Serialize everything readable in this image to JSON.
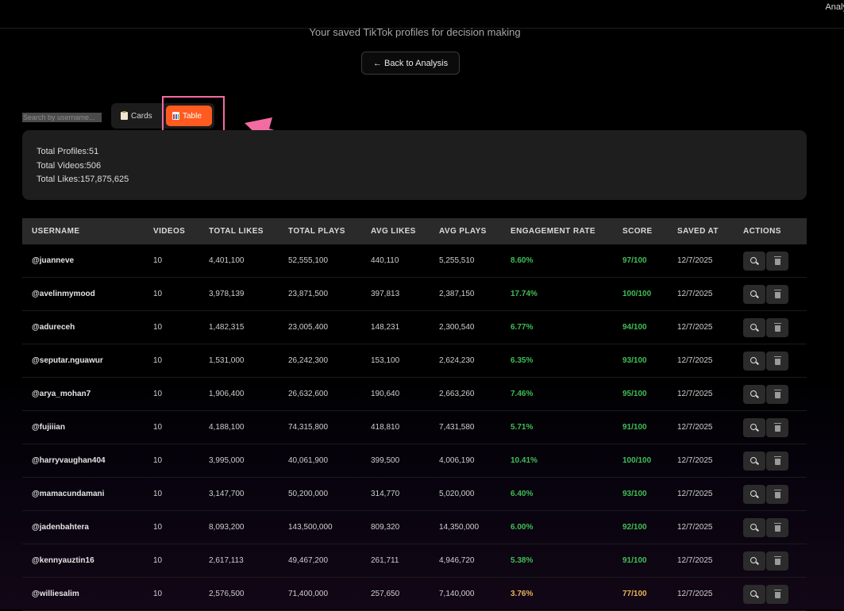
{
  "header": {
    "nav_cut_label": "Analy",
    "subtitle": "Your saved TikTok profiles for decision making"
  },
  "back_button": {
    "label": "← Back to Analysis"
  },
  "search": {
    "placeholder": "Search by username..."
  },
  "view_toggle": {
    "cards_label": "Cards",
    "cards_icon": "clipboard-icon",
    "table_label": "Table",
    "table_icon": "bar-chart-icon",
    "active": "Table"
  },
  "colors": {
    "accent": "#ff5a1f",
    "highlight": "#f46ba3",
    "positive": "#3fbf55",
    "warning": "#e9b25a"
  },
  "stats": {
    "total_profiles": "Total Profiles:51",
    "total_videos": "Total Videos:506",
    "total_likes": "Total Likes:157,875,625"
  },
  "table": {
    "columns": [
      "USERNAME",
      "VIDEOS",
      "TOTAL LIKES",
      "TOTAL PLAYS",
      "AVG LIKES",
      "AVG PLAYS",
      "ENGAGEMENT RATE",
      "SCORE",
      "SAVED AT",
      "ACTIONS"
    ],
    "rows": [
      {
        "username": "@juanneve",
        "videos": "10",
        "total_likes": "4,401,100",
        "total_plays": "52,555,100",
        "avg_likes": "440,110",
        "avg_plays": "5,255,510",
        "engagement": "8.60%",
        "score": "97/100",
        "saved_at": "12/7/2025"
      },
      {
        "username": "@avelinmymood",
        "videos": "10",
        "total_likes": "3,978,139",
        "total_plays": "23,871,500",
        "avg_likes": "397,813",
        "avg_plays": "2,387,150",
        "engagement": "17.74%",
        "score": "100/100",
        "saved_at": "12/7/2025"
      },
      {
        "username": "@adureceh",
        "videos": "10",
        "total_likes": "1,482,315",
        "total_plays": "23,005,400",
        "avg_likes": "148,231",
        "avg_plays": "2,300,540",
        "engagement": "6.77%",
        "score": "94/100",
        "saved_at": "12/7/2025"
      },
      {
        "username": "@seputar.nguawur",
        "videos": "10",
        "total_likes": "1,531,000",
        "total_plays": "26,242,300",
        "avg_likes": "153,100",
        "avg_plays": "2,624,230",
        "engagement": "6.35%",
        "score": "93/100",
        "saved_at": "12/7/2025"
      },
      {
        "username": "@arya_mohan7",
        "videos": "10",
        "total_likes": "1,906,400",
        "total_plays": "26,632,600",
        "avg_likes": "190,640",
        "avg_plays": "2,663,260",
        "engagement": "7.46%",
        "score": "95/100",
        "saved_at": "12/7/2025"
      },
      {
        "username": "@fujiiian",
        "videos": "10",
        "total_likes": "4,188,100",
        "total_plays": "74,315,800",
        "avg_likes": "418,810",
        "avg_plays": "7,431,580",
        "engagement": "5.71%",
        "score": "91/100",
        "saved_at": "12/7/2025"
      },
      {
        "username": "@harryvaughan404",
        "videos": "10",
        "total_likes": "3,995,000",
        "total_plays": "40,061,900",
        "avg_likes": "399,500",
        "avg_plays": "4,006,190",
        "engagement": "10.41%",
        "score": "100/100",
        "saved_at": "12/7/2025"
      },
      {
        "username": "@mamacundamani",
        "videos": "10",
        "total_likes": "3,147,700",
        "total_plays": "50,200,000",
        "avg_likes": "314,770",
        "avg_plays": "5,020,000",
        "engagement": "6.40%",
        "score": "93/100",
        "saved_at": "12/7/2025"
      },
      {
        "username": "@jadenbahtera",
        "videos": "10",
        "total_likes": "8,093,200",
        "total_plays": "143,500,000",
        "avg_likes": "809,320",
        "avg_plays": "14,350,000",
        "engagement": "6.00%",
        "score": "92/100",
        "saved_at": "12/7/2025"
      },
      {
        "username": "@kennyauztin16",
        "videos": "10",
        "total_likes": "2,617,113",
        "total_plays": "49,467,200",
        "avg_likes": "261,711",
        "avg_plays": "4,946,720",
        "engagement": "5.38%",
        "score": "91/100",
        "saved_at": "12/7/2025"
      },
      {
        "username": "@williesalim",
        "videos": "10",
        "total_likes": "2,576,500",
        "total_plays": "71,400,000",
        "avg_likes": "257,650",
        "avg_plays": "7,140,000",
        "engagement": "3.76%",
        "score": "77/100",
        "saved_at": "12/7/2025"
      }
    ],
    "row_actions": [
      {
        "name": "view-button",
        "icon": "magnifier-icon"
      },
      {
        "name": "delete-button",
        "icon": "trash-icon"
      }
    ]
  }
}
